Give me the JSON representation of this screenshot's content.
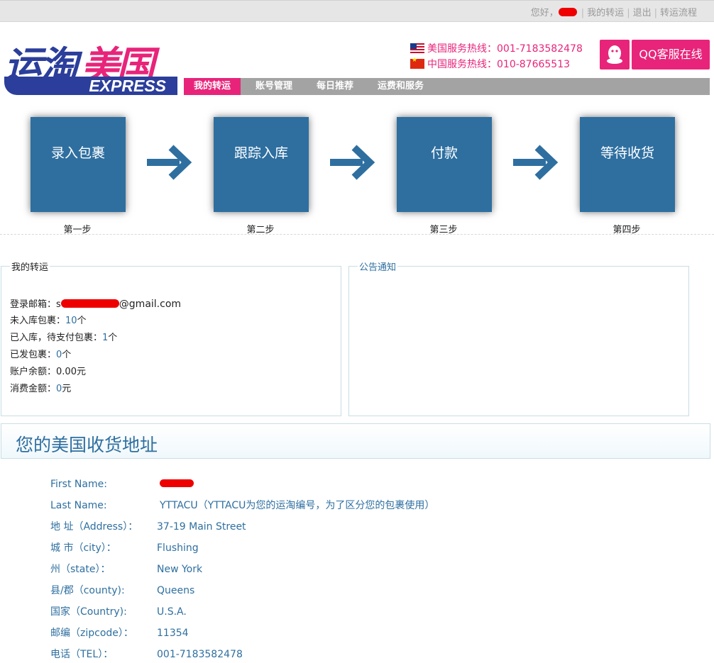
{
  "topbar": {
    "greeting": "您好，",
    "link_my_shipping": "我的转运",
    "link_logout": "退出",
    "link_flow": "转运流程"
  },
  "logo": {
    "cn_part1": "运淘",
    "cn_part2": "美国",
    "express": "EXPRESS"
  },
  "hotlines": {
    "us": "美国服务热线：001-7183582478",
    "cn": "中国服务热线：010-87665513"
  },
  "qq": {
    "label": "QQ客服在线"
  },
  "nav": {
    "items": [
      "我的转运",
      "账号管理",
      "每日推荐",
      "运费和服务"
    ],
    "active": "我的转运"
  },
  "steps": [
    {
      "title": "录入包裹",
      "label": "第一步"
    },
    {
      "title": "跟踪入库",
      "label": "第二步"
    },
    {
      "title": "付款",
      "label": "第三步"
    },
    {
      "title": "等待收货",
      "label": "第四步"
    }
  ],
  "my_shipping": {
    "legend": "我的转运",
    "email_label": "登录邮箱：",
    "email_prefix": "s",
    "email_suffix": "@gmail.com",
    "not_in_label": "未入库包裹：",
    "not_in_value": "10",
    "unit": "个",
    "pending_pay_label": "已入库，待支付包裹：",
    "pending_pay_value": "1",
    "shipped_label": "已发包裹：",
    "shipped_value": "0",
    "balance_label": "账户余额：",
    "balance_value": "0.00元",
    "spent_label": "消费金额：",
    "spent_value": "0",
    "spent_unit": "元"
  },
  "notice": {
    "legend": "公告通知"
  },
  "address": {
    "title": "您的美国收货地址",
    "rows": [
      {
        "label": "First Name:",
        "value": ""
      },
      {
        "label": "Last Name:",
        "value": "YTTACU（YTTACU为您的运淘编号，为了区分您的包裹使用）"
      },
      {
        "label": "地 址（Address）：",
        "value": "37-19 Main Street"
      },
      {
        "label": "城 市（city）：",
        "value": "Flushing"
      },
      {
        "label": "州（state）：",
        "value": "New York"
      },
      {
        "label": "县/郡（county):",
        "value": "Queens"
      },
      {
        "label": "国家（Country):",
        "value": "U.S.A."
      },
      {
        "label": "邮编（zipcode）：",
        "value": "11354"
      },
      {
        "label": "电话（TEL）：",
        "value": "001-7183582478"
      }
    ]
  },
  "colors": {
    "brand_blue": "#2b3e9b",
    "brand_pink": "#e8247a",
    "step_blue": "#2e6fa0"
  }
}
